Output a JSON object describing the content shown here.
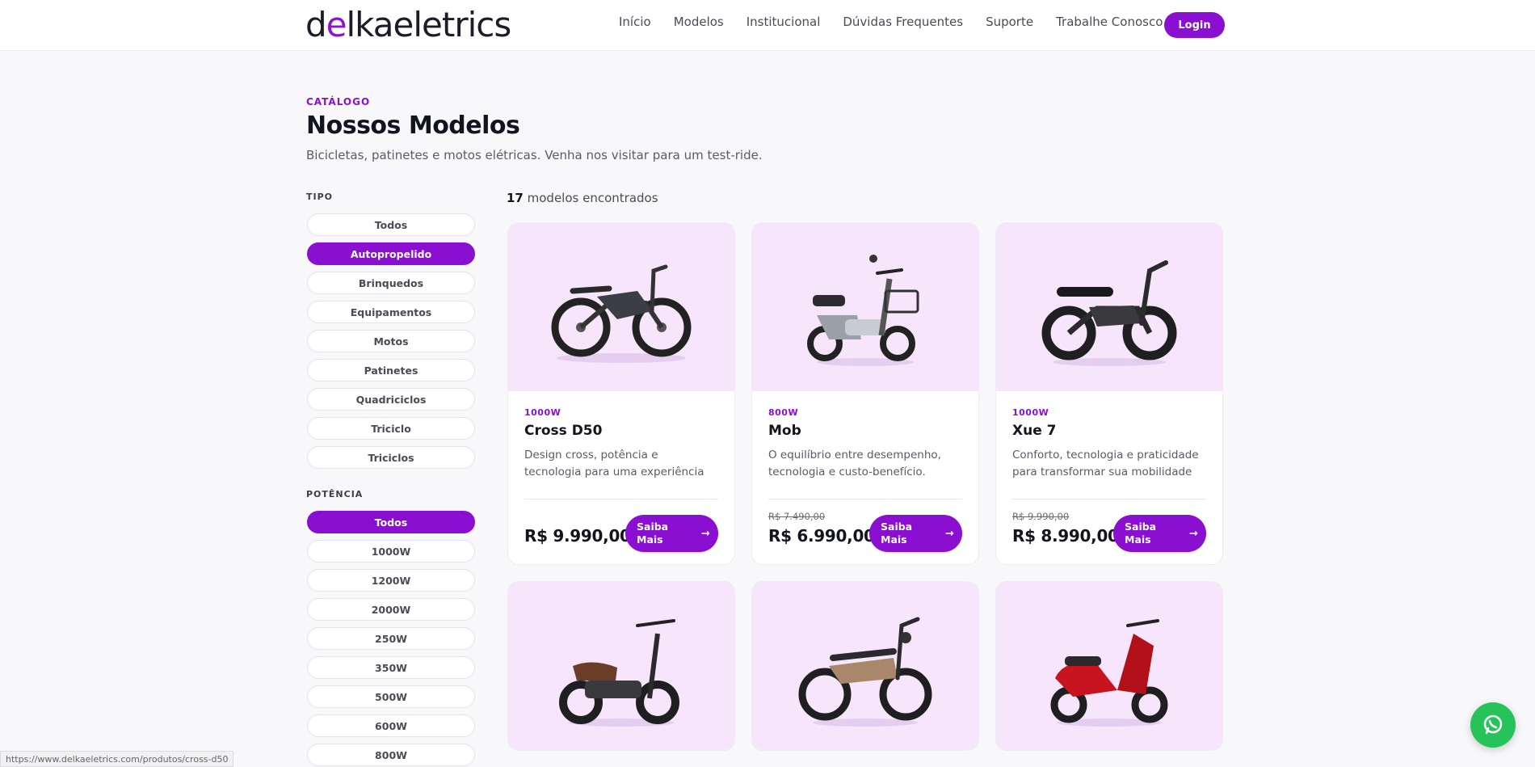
{
  "header": {
    "logo": {
      "part1": "d",
      "accent": "e",
      "part2": "lka",
      "part3": "eletrics"
    },
    "nav": [
      "Início",
      "Modelos",
      "Institucional",
      "Dúvidas Frequentes",
      "Suporte",
      "Trabalhe Conosco"
    ],
    "login_label": "Login"
  },
  "hero": {
    "eyebrow": "CATÁLOGO",
    "title": "Nossos Modelos",
    "subtitle": "Bicicletas, patinetes e motos elétricas. Venha nos visitar para um test-ride."
  },
  "filters": {
    "tipo": {
      "heading": "TIPO",
      "options": [
        "Todos",
        "Autopropelido",
        "Brinquedos",
        "Equipamentos",
        "Motos",
        "Patinetes",
        "Quadriciclos",
        "Triciclo",
        "Triciclos"
      ],
      "selected": "Autopropelido"
    },
    "potencia": {
      "heading": "POTÊNCIA",
      "options": [
        "Todos",
        "1000W",
        "1200W",
        "2000W",
        "250W",
        "350W",
        "500W",
        "600W",
        "800W"
      ],
      "selected": "Todos"
    }
  },
  "results": {
    "count": "17",
    "label": " modelos encontrados"
  },
  "products": [
    {
      "power": "1000W",
      "name": "Cross D50",
      "description": "Design cross, potência e tecnologia para uma experiência única sobre duas rodas.",
      "old_price": "",
      "price": "R$ 9.990,00",
      "button": "Saiba Mais",
      "image": "bike-cross-icon"
    },
    {
      "power": "800W",
      "name": "Mob",
      "description": "O equilíbrio entre desempenho, tecnologia e custo-benefício.",
      "old_price": "R$ 7.490,00",
      "price": "R$ 6.990,00",
      "button": "Saiba Mais",
      "image": "scooter-basket-icon"
    },
    {
      "power": "1000W",
      "name": "Xue 7",
      "description": "Conforto, tecnologia e praticidade para transformar sua mobilidade urbana.",
      "old_price": "R$ 9.990,00",
      "price": "R$ 8.990,00",
      "button": "Saiba Mais",
      "image": "bike-fat-icon"
    },
    {
      "image": "chopper-scooter-icon"
    },
    {
      "image": "bike-moto-icon"
    },
    {
      "image": "red-scooter-icon"
    }
  ],
  "statusbar": "https://www.delkaeletrics.com/produtos/cross-d50",
  "colors": {
    "accent": "#8a0fd0",
    "card_image_bg": "#f6e5fb",
    "whatsapp": "#25c35a"
  }
}
